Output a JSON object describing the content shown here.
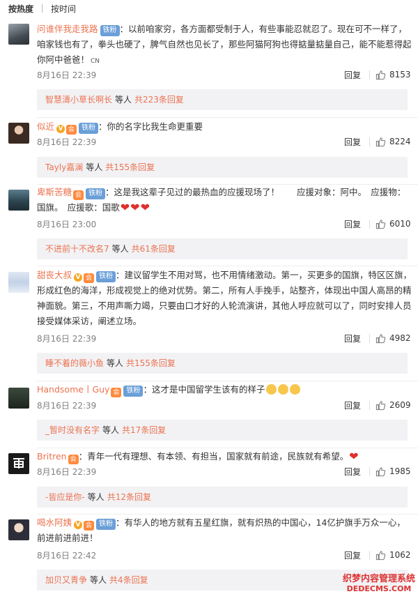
{
  "tabs": {
    "hot": "按热度",
    "time": "按时间"
  },
  "ui": {
    "reply": "回复",
    "fan_badge": "铁粉",
    "vip_v": "V",
    "member_icon": "会",
    "others": "等人"
  },
  "colors": {
    "username": "#eb7350",
    "fan_badge_bg": "#6a9fd8",
    "reply_box_bg": "#f2f2f5",
    "heart": "#e0302b"
  },
  "comments": [
    {
      "user": "问谁伴我走我路",
      "text": "：以前咱家穷，各方面都受制于人，有些事能忍就忍了。现在可不一样了，咱家钱也有了，拳头也硬了，脾气自然也见长了，那些阿猫阿狗也得掂量掂量自己，能不能惹得起你阿中爸爸！",
      "suffix": "CN",
      "time": "8月16日 22:39",
      "likes": "8153",
      "sub_user": "智慧濤小草长啊长",
      "sub_count": "共223条回复"
    },
    {
      "user": "似近",
      "text": "：你的名字比我生命更重要",
      "time": "8月16日 22:39",
      "likes": "8224",
      "sub_user": "Tayly嘉澜",
      "sub_count": "共155条回复"
    },
    {
      "user": "卑斯苦糖",
      "text": "：这是我这辈子见过的最热血的应援现场了！　　应援对象：阿中。　应援物：国旗。　应援歌：国歌",
      "time": "8月16日 23:00",
      "likes": "6010",
      "sub_user": "不进前十不改名7",
      "sub_count": "共61条回复"
    },
    {
      "user": "甜丧大叔",
      "text": "：建议留学生不用对骂，也不用情绪激动。第一，买更多的国旗，特区区旗，形成红色的海洋，形成视觉上的绝对优势。第二，所有人手挽手，站整齐，体现出中国人高昂的精神面貌。第三，不用声嘶力竭，只要由口才好的人轮流演讲，其他人呼应就可以了，同时安排人员接受媒体采访，阐述立场。",
      "time": "8月16日 22:39",
      "likes": "4982",
      "sub_user": "睡不着的薇小鱼",
      "sub_count": "共155条回复"
    },
    {
      "user": "Handsome丨Guy",
      "text": "：这才是中国留学生该有的样子",
      "time": "8月16日 22:39",
      "likes": "2609",
      "sub_user": "_暂时没有名字",
      "sub_count": "共17条回复"
    },
    {
      "user": "Britren",
      "text": "：青年一代有理想、有本领、有担当，国家就有前途，民族就有希望。",
      "time": "8月16日 22:39",
      "likes": "1985",
      "sub_user": "-皆应是你-",
      "sub_count": "共12条回复"
    },
    {
      "user": "喝水阿姨",
      "text": "：有华人的地方就有五星红旗，就有炽热的中国心，14亿护旗手万众一心，前进前进前进！",
      "time": "8月16日 22:42",
      "likes": "1062",
      "sub_user": "加贝又青争",
      "sub_count": "共4条回复"
    }
  ],
  "watermark": {
    "cn": "织梦内容管理系统",
    "en": "DEDECMS.COM"
  }
}
